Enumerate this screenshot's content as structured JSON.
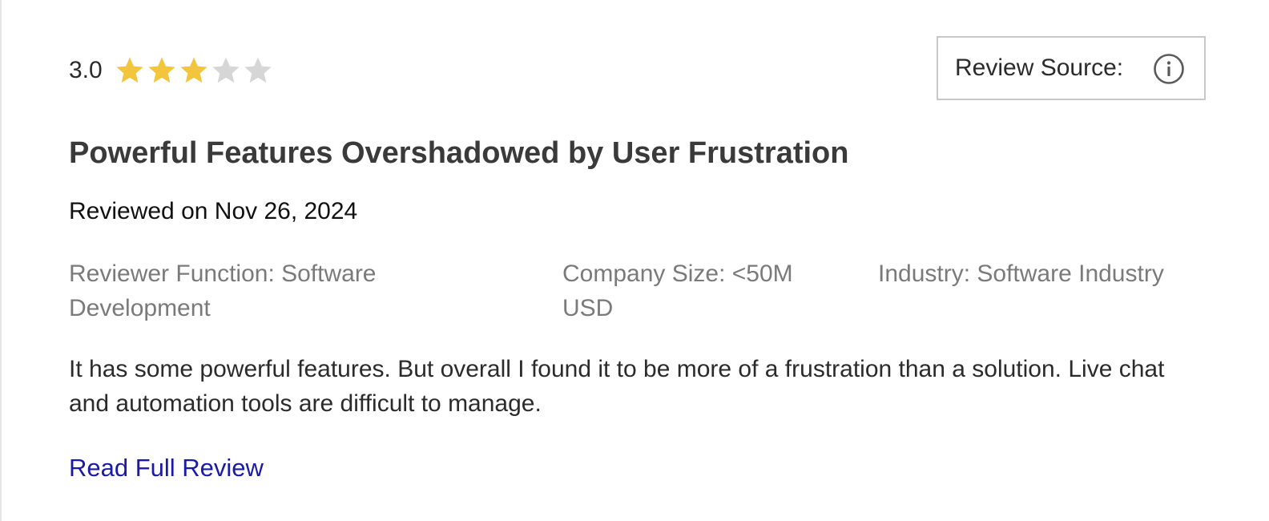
{
  "review": {
    "rating_text": "3.0",
    "rating_value": 3,
    "rating_max": 5,
    "star_filled_color": "#f2c53d",
    "star_empty_color": "#d6d6d6",
    "source_label": "Review Source:",
    "title": "Powerful Features Overshadowed by User Frustration",
    "reviewed_on": "Reviewed on Nov 26, 2024",
    "meta": {
      "function": "Reviewer Function: Software Development",
      "company_size": "Company Size: <50M USD",
      "industry": "Industry: Software Industry"
    },
    "summary": "It has some powerful features. But overall I found it to be more of a frustration than a solution. Live chat and automation tools are difficult to manage.",
    "read_more_label": "Read Full Review",
    "link_color": "#1a1aa6"
  }
}
